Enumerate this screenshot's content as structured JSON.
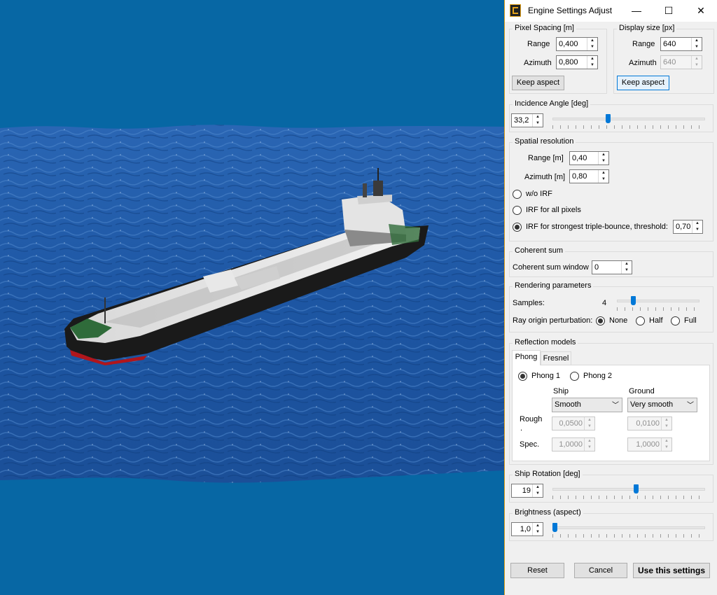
{
  "window": {
    "title": "Engine Settings Adjust",
    "minimize": "—",
    "maximize": "☐",
    "close": "✕"
  },
  "pixel_spacing": {
    "legend": "Pixel Spacing [m]",
    "range_label": "Range",
    "range_value": "0,400",
    "azimuth_label": "Azimuth",
    "azimuth_value": "0,800",
    "keep_aspect": "Keep aspect"
  },
  "display_size": {
    "legend": "Display size [px]",
    "range_label": "Range",
    "range_value": "640",
    "azimuth_label": "Azimuth",
    "azimuth_value": "640",
    "keep_aspect": "Keep aspect"
  },
  "incidence": {
    "legend": "Incidence Angle [deg]",
    "value": "33,2",
    "slider_fraction": 0.36
  },
  "spatial": {
    "legend": "Spatial resolution",
    "range_label": "Range [m]",
    "range_value": "0,40",
    "azimuth_label": "Azimuth [m]",
    "azimuth_value": "0,80",
    "options": [
      "w/o IRF",
      "IRF for all pixels",
      "IRF for strongest triple-bounce, threshold:"
    ],
    "selected": 2,
    "threshold": "0,70"
  },
  "coherent": {
    "legend": "Coherent sum",
    "window_label": "Coherent sum window",
    "window_value": "0"
  },
  "rendering": {
    "legend": "Rendering parameters",
    "samples_label": "Samples:",
    "samples_value": "4",
    "samples_fraction": 0.18,
    "perturb_label": "Ray origin perturbation:",
    "perturb_options": [
      "None",
      "Half",
      "Full"
    ],
    "perturb_selected": 0
  },
  "reflection": {
    "legend": "Reflection models",
    "tabs": [
      "Phong",
      "Fresnel"
    ],
    "selected_tab": 0,
    "phong_options": [
      "Phong 1",
      "Phong 2"
    ],
    "phong_selected": 0,
    "ship_label": "Ship",
    "ground_label": "Ground",
    "ship_select": "Smooth",
    "ground_select": "Very smooth",
    "rough_label": "Rough",
    "rough_sub": ".",
    "spec_label": "Spec.",
    "ship_rough": "0,0500",
    "ground_rough": "0,0100",
    "ship_spec": "1,0000",
    "ground_spec": "1,0000"
  },
  "ship_rotation": {
    "legend": "Ship Rotation [deg]",
    "value": "19",
    "slider_fraction": 0.55
  },
  "brightness": {
    "legend": "Brightness (aspect)",
    "value": "1,0",
    "slider_fraction": 0.0
  },
  "buttons": {
    "reset": "Reset",
    "cancel": "Cancel",
    "use": "Use this settings"
  },
  "icons": {
    "app": "app-logo-icon",
    "spin_up": "▲",
    "spin_down": "▼",
    "chevron": "﹀"
  },
  "colors": {
    "background": "#0767a4",
    "water": "#1d5ca8",
    "accent": "#0078d7",
    "window_border": "#e3a21a"
  }
}
